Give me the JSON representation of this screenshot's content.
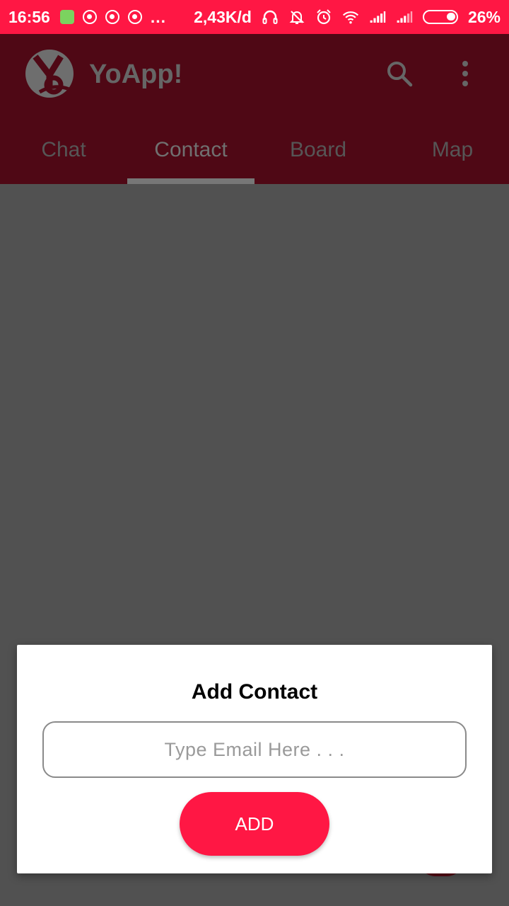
{
  "colors": {
    "status_bar": "#ff1744",
    "app_bar_dimmed": "#4f0815",
    "overlay": "#515151",
    "accent": "#ff1744"
  },
  "status_bar": {
    "time": "16:56",
    "notification_icons": [
      "android-notification-icon",
      "whatsapp-icon",
      "whatsapp-icon",
      "whatsapp-icon"
    ],
    "more": "...",
    "data_speed": "2,43K/d",
    "battery": "26%"
  },
  "app_bar": {
    "title": "YoApp!",
    "tabs": [
      "Chat",
      "Contact",
      "Board",
      "Map"
    ],
    "active_tab": "Contact"
  },
  "dialog": {
    "title": "Add Contact",
    "email_placeholder": "Type Email Here . . .",
    "email_value": "",
    "add_label": "ADD"
  }
}
